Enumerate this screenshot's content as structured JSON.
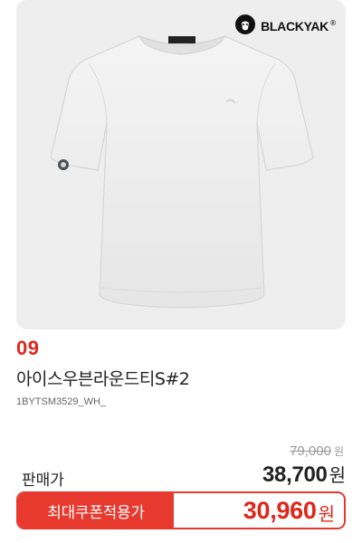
{
  "brand": {
    "name": "BLACKYAK",
    "registered_mark": "®",
    "icon": "yak-logo-icon"
  },
  "product": {
    "image_icon": "tshirt-icon",
    "rank": "09",
    "name": "아이스우븐라운드티S#2",
    "code": "1BYTSM3529_WH_"
  },
  "pricing": {
    "original_price": "79,000",
    "original_unit": "원",
    "sale_label": "판매가",
    "sale_price": "38,700",
    "sale_unit": "원",
    "coupon_label": "최대쿠폰적용가",
    "coupon_price": "30,960",
    "coupon_unit": "원"
  },
  "colors": {
    "accent_red": "#e0261b",
    "coupon_red": "#e8392e",
    "image_bg": "#eeeeef",
    "strike_gray": "#9a9a9a"
  }
}
